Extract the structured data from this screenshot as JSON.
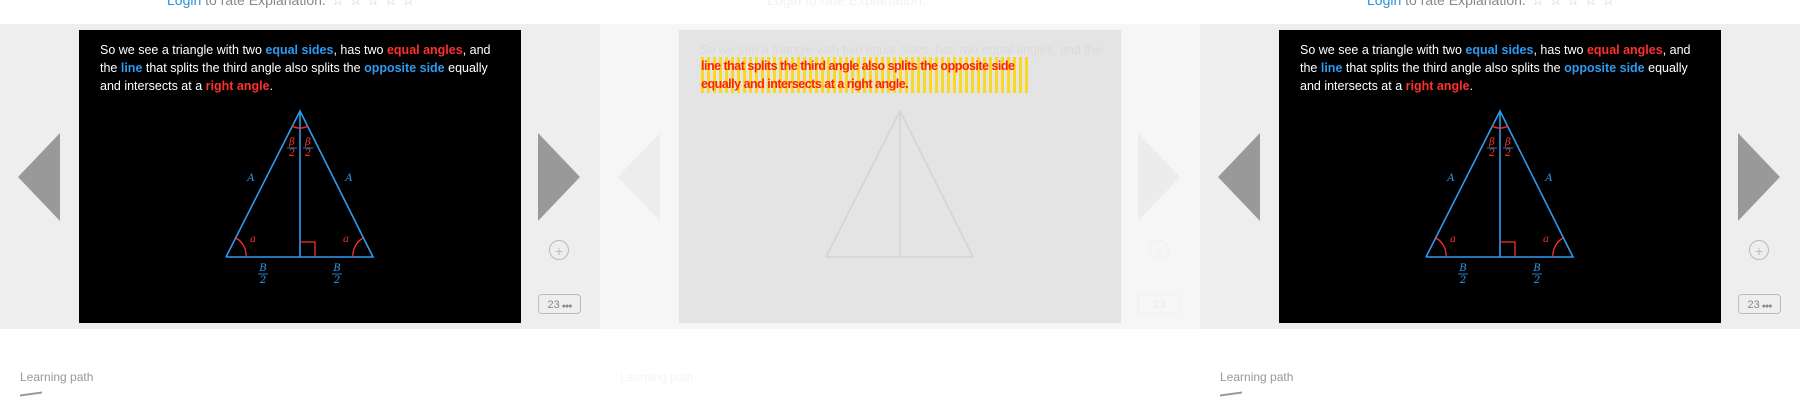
{
  "rating": {
    "login_label": "Login",
    "rest_text": " to rate Explanation.",
    "stars": "☆☆☆☆☆"
  },
  "slide": {
    "t1": "So we see a triangle with two ",
    "equal_sides": "equal sides",
    "t2": ", has two ",
    "equal_angles": "equal angles",
    "t3": ", and the ",
    "line": "line",
    "t4": " that splits the third angle also splits the ",
    "opposite_side": "opposite side",
    "t5": " equally and intersects at a ",
    "right_angle": "right angle",
    "t6": ".",
    "glitch_text": "line that splits the third angle also splits the opposite side equally and intersects at a right angle.",
    "triangle": {
      "side_label": "A",
      "base_angle_label": "a",
      "half_angle_num": "β",
      "half_base_num": "B",
      "den": "2"
    }
  },
  "nav": {
    "add_icon": "+",
    "count": "23",
    "count_dots": "●●●"
  },
  "footer": {
    "learning_path": "Learning path"
  },
  "icons": {
    "prev": "chevron-left-icon",
    "next": "chevron-right-icon",
    "add": "plus-circle-icon"
  },
  "colors": {
    "blue": "#2e9bf0",
    "red": "#ff2f2f",
    "link": "#2b8fd6"
  }
}
